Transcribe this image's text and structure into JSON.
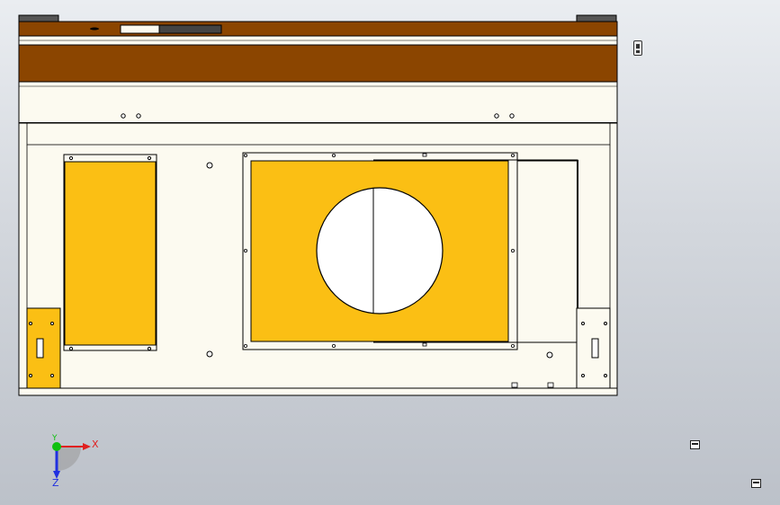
{
  "viewport": {
    "background_top": "#eaedf1",
    "background_bottom": "#bcc1c9"
  },
  "model": {
    "frame_fill": "#fcfaf0",
    "edge_color": "#000000",
    "top_strip_color": "#8b4500",
    "panel_color": "#fbbf14",
    "light_panel_color": "#f5f0e0",
    "opening_color": "#ffffff"
  },
  "triad": {
    "x_label": "X",
    "y_label": "Y",
    "z_label": "Z",
    "x_color": "#e02020",
    "y_color": "#10c010",
    "z_color": "#2030e0"
  },
  "icons": {
    "side": "view-orientation-icon",
    "bottom_right_1": "display-style-icon",
    "bottom_right_2": "viewport-layout-icon"
  }
}
